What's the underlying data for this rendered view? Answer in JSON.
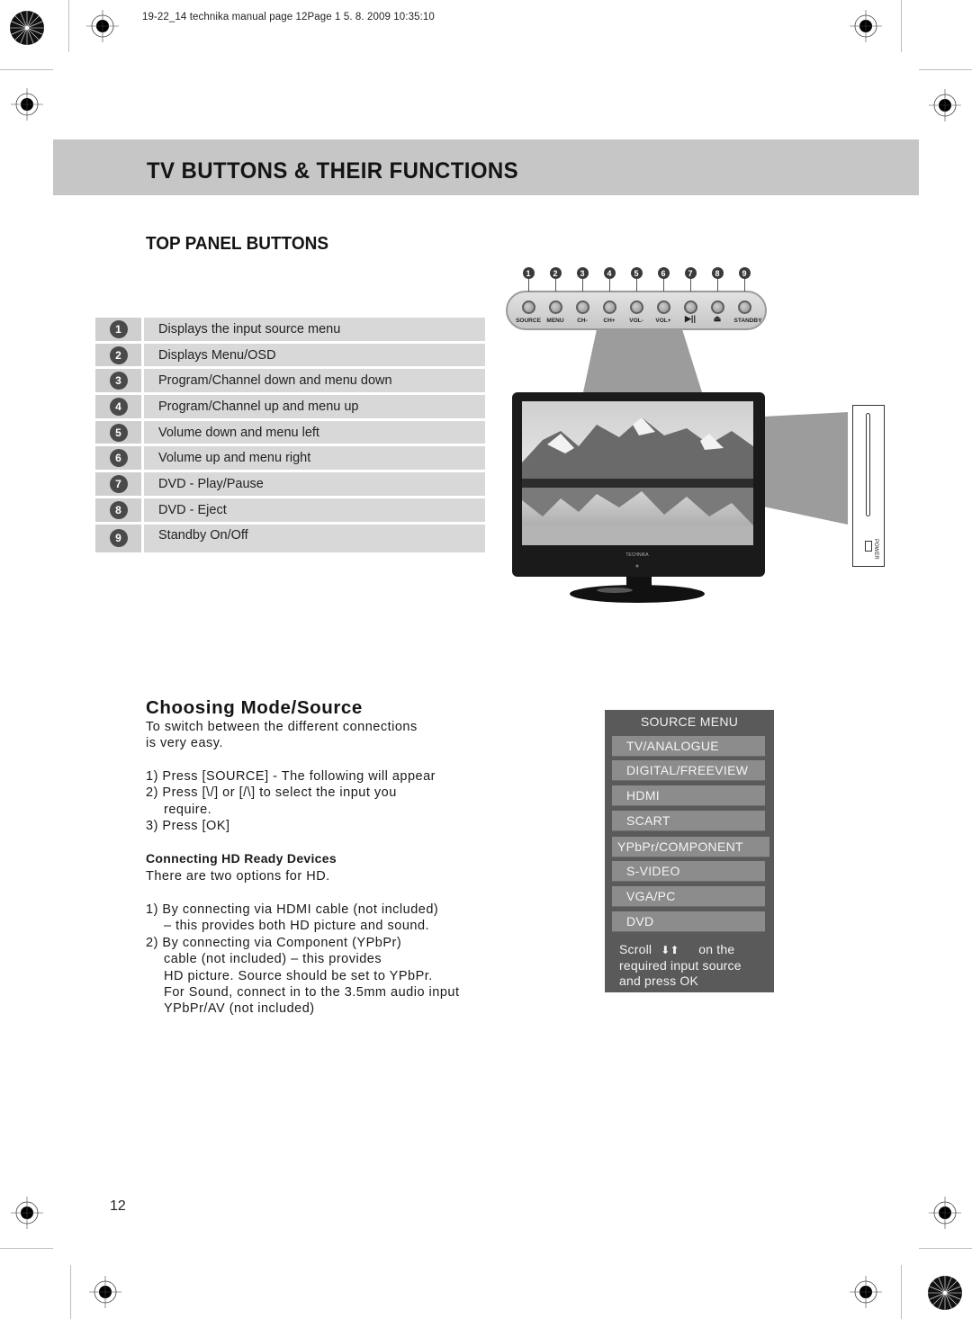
{
  "slug": "19-22_14 technika manual page 12Page 1   5. 8. 2009   10:35:10",
  "header": {
    "title": "TV BUTTONS & THEIR FUNCTIONS"
  },
  "top_panel": {
    "title": "TOP PANEL BUTTONS",
    "functions": [
      {
        "num": "1",
        "desc": "Displays the input source menu"
      },
      {
        "num": "2",
        "desc": "Displays Menu/OSD"
      },
      {
        "num": "3",
        "desc": "Program/Channel down and menu down"
      },
      {
        "num": "4",
        "desc": "Program/Channel up and menu up"
      },
      {
        "num": "5",
        "desc": "Volume down and menu left"
      },
      {
        "num": "6",
        "desc": "Volume up and menu right"
      },
      {
        "num": "7",
        "desc": "DVD - Play/Pause"
      },
      {
        "num": "8",
        "desc": "DVD - Eject"
      },
      {
        "num": "9",
        "desc": "Standby On/Off"
      }
    ],
    "panel_buttons": [
      {
        "num": "1",
        "label": "SOURCE"
      },
      {
        "num": "2",
        "label": "MENU"
      },
      {
        "num": "3",
        "label": "CH-"
      },
      {
        "num": "4",
        "label": "CH+"
      },
      {
        "num": "5",
        "label": "VOL-"
      },
      {
        "num": "6",
        "label": "VOL+"
      },
      {
        "num": "7",
        "label": "▶||"
      },
      {
        "num": "8",
        "label": "⏏"
      },
      {
        "num": "9",
        "label": "STANDBY"
      }
    ],
    "side_panel": {
      "power_label": "POWER"
    },
    "tv_brand": "TECHNIKA"
  },
  "choosing": {
    "title": "Choosing Mode/Source",
    "intro": [
      "To switch between the different connections",
      "is very easy."
    ],
    "steps": [
      "1) Press [SOURCE] - The following will appear",
      "2) Press [\\/] or [/\\] to select the input you",
      "require.",
      "3) Press [OK]"
    ],
    "hd_title": "Connecting HD Ready Devices",
    "hd_intro": "There are two options for HD.",
    "hd_steps": [
      "1) By connecting via HDMI cable (not included)",
      "– this provides both HD picture and sound.",
      "2) By connecting via Component (YPbPr)",
      "cable (not included) – this provides",
      "HD picture. Source should be set to YPbPr.",
      "For Sound, connect in to the 3.5mm audio input",
      "YPbPr/AV (not included)"
    ]
  },
  "source_menu": {
    "title": "SOURCE MENU",
    "items": [
      "TV/ANALOGUE",
      "DIGITAL/FREEVIEW",
      "HDMI",
      "SCART",
      "YPbPr/COMPONENT",
      "S-VIDEO",
      "VGA/PC",
      "DVD"
    ],
    "footer_scroll": "Scroll",
    "footer_arrows": "⬇⬆",
    "footer_on": "on the",
    "footer_line2": "required input source",
    "footer_line3": "and press OK"
  },
  "page_number": "12"
}
